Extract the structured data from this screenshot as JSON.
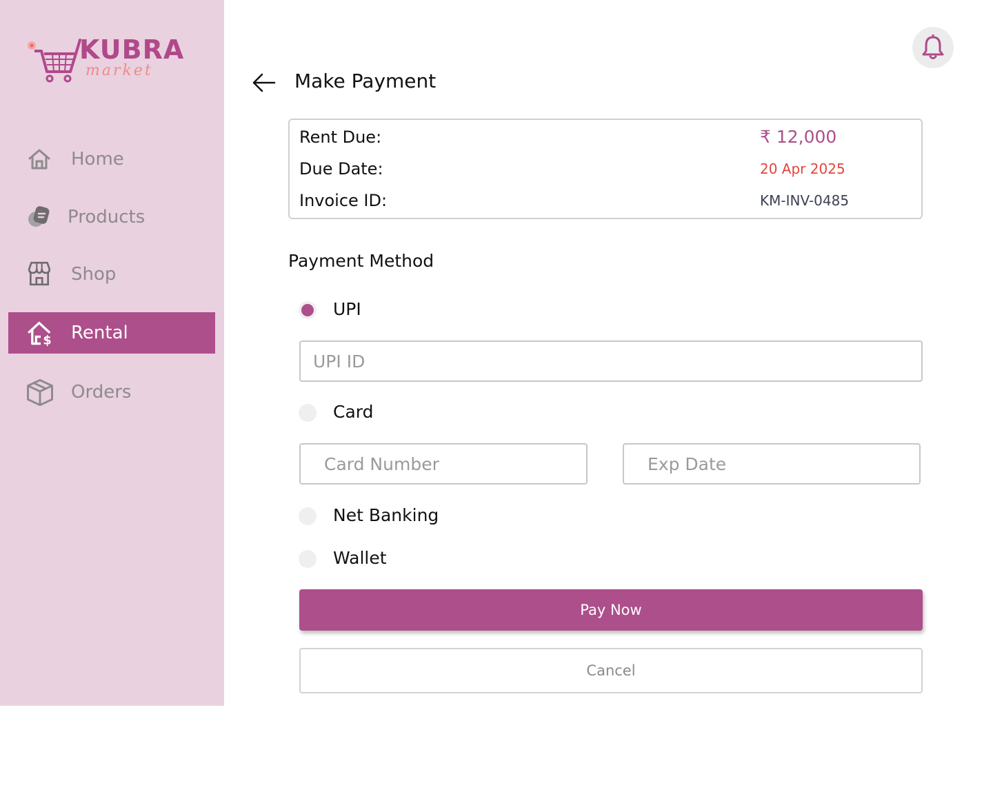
{
  "brand": {
    "name": "KUBRA",
    "tagline": "market",
    "accent_color": "#ad4f8b",
    "sidebar_bg": "#e9d1df"
  },
  "sidebar": {
    "items": [
      {
        "label": "Home",
        "icon": "home-icon",
        "active": false
      },
      {
        "label": "Products",
        "icon": "products-icon",
        "active": false
      },
      {
        "label": "Shop",
        "icon": "shop-icon",
        "active": false
      },
      {
        "label": "Rental",
        "icon": "rental-icon",
        "active": true
      },
      {
        "label": "Orders",
        "icon": "orders-icon",
        "active": false
      }
    ]
  },
  "header": {
    "notification_icon": "bell-icon"
  },
  "page": {
    "title": "Make Payment",
    "back_icon": "arrow-left-icon"
  },
  "summary": {
    "rent_due_label": "Rent Due:",
    "rent_due_value": "₹ 12,000",
    "due_date_label": "Due Date:",
    "due_date_value": "20 Apr 2025",
    "invoice_label": "Invoice ID:",
    "invoice_value": "KM-INV-0485",
    "due_date_color": "#e2453c"
  },
  "payment": {
    "section_title": "Payment Method",
    "selected": "UPI",
    "upi_label": "UPI",
    "upi_placeholder": "UPI ID",
    "card_label": "Card",
    "card_number_placeholder": "Card Number",
    "exp_date_placeholder": "Exp Date",
    "netbanking_label": "Net Banking",
    "wallet_label": "Wallet"
  },
  "actions": {
    "pay_label": "Pay Now",
    "cancel_label": "Cancel"
  }
}
